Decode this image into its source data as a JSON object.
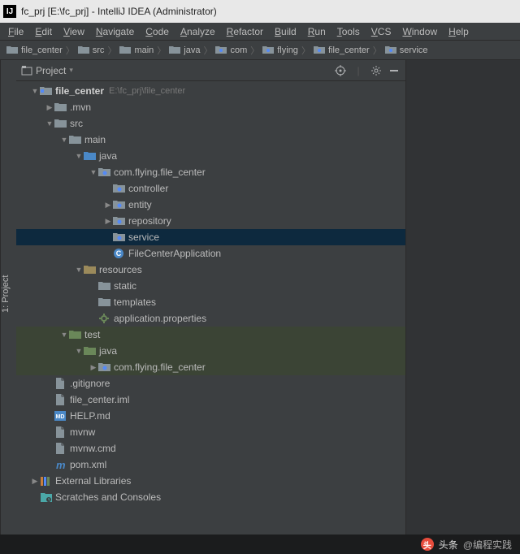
{
  "titlebar": {
    "text": "fc_prj [E:\\fc_prj] - IntelliJ IDEA (Administrator)"
  },
  "menu": [
    "File",
    "Edit",
    "View",
    "Navigate",
    "Code",
    "Analyze",
    "Refactor",
    "Build",
    "Run",
    "Tools",
    "VCS",
    "Window",
    "Help"
  ],
  "breadcrumb": [
    "file_center",
    "src",
    "main",
    "java",
    "com",
    "flying",
    "file_center",
    "service"
  ],
  "panel": {
    "title": "Project"
  },
  "sidebar_tab": "1: Project",
  "tree": [
    {
      "d": 0,
      "exp": "open",
      "icon": "module",
      "label": "file_center",
      "bold": true,
      "path": "E:\\fc_prj\\file_center"
    },
    {
      "d": 1,
      "exp": "closed",
      "icon": "folder",
      "label": ".mvn"
    },
    {
      "d": 1,
      "exp": "open",
      "icon": "folder-src",
      "label": "src"
    },
    {
      "d": 2,
      "exp": "open",
      "icon": "folder-src",
      "label": "main"
    },
    {
      "d": 3,
      "exp": "open",
      "icon": "folder-java",
      "label": "java"
    },
    {
      "d": 4,
      "exp": "open",
      "icon": "package",
      "label": "com.flying.file_center"
    },
    {
      "d": 5,
      "exp": "none",
      "icon": "package",
      "label": "controller"
    },
    {
      "d": 5,
      "exp": "closed",
      "icon": "package",
      "label": "entity"
    },
    {
      "d": 5,
      "exp": "closed",
      "icon": "package",
      "label": "repository"
    },
    {
      "d": 5,
      "exp": "none",
      "icon": "package",
      "label": "service",
      "sel": true
    },
    {
      "d": 5,
      "exp": "none",
      "icon": "class",
      "label": "FileCenterApplication"
    },
    {
      "d": 3,
      "exp": "open",
      "icon": "folder-res",
      "label": "resources"
    },
    {
      "d": 4,
      "exp": "none",
      "icon": "folder",
      "label": "static"
    },
    {
      "d": 4,
      "exp": "none",
      "icon": "folder",
      "label": "templates"
    },
    {
      "d": 4,
      "exp": "none",
      "icon": "props",
      "label": "application.properties"
    },
    {
      "d": 2,
      "exp": "open",
      "icon": "folder-test",
      "label": "test",
      "hl": "test"
    },
    {
      "d": 3,
      "exp": "open",
      "icon": "folder-test-java",
      "label": "java",
      "hl": "test"
    },
    {
      "d": 4,
      "exp": "closed",
      "icon": "package",
      "label": "com.flying.file_center",
      "hl": "test"
    },
    {
      "d": 1,
      "exp": "none",
      "icon": "file",
      "label": ".gitignore"
    },
    {
      "d": 1,
      "exp": "none",
      "icon": "file",
      "label": "file_center.iml"
    },
    {
      "d": 1,
      "exp": "none",
      "icon": "md",
      "label": "HELP.md"
    },
    {
      "d": 1,
      "exp": "none",
      "icon": "file",
      "label": "mvnw"
    },
    {
      "d": 1,
      "exp": "none",
      "icon": "file",
      "label": "mvnw.cmd"
    },
    {
      "d": 1,
      "exp": "none",
      "icon": "maven",
      "label": "pom.xml"
    },
    {
      "d": 0,
      "exp": "closed",
      "icon": "lib",
      "label": "External Libraries"
    },
    {
      "d": 0,
      "exp": "none",
      "icon": "scratch",
      "label": "Scratches and Consoles"
    }
  ],
  "footer": {
    "brand": "头条",
    "handle": "@编程实践"
  }
}
